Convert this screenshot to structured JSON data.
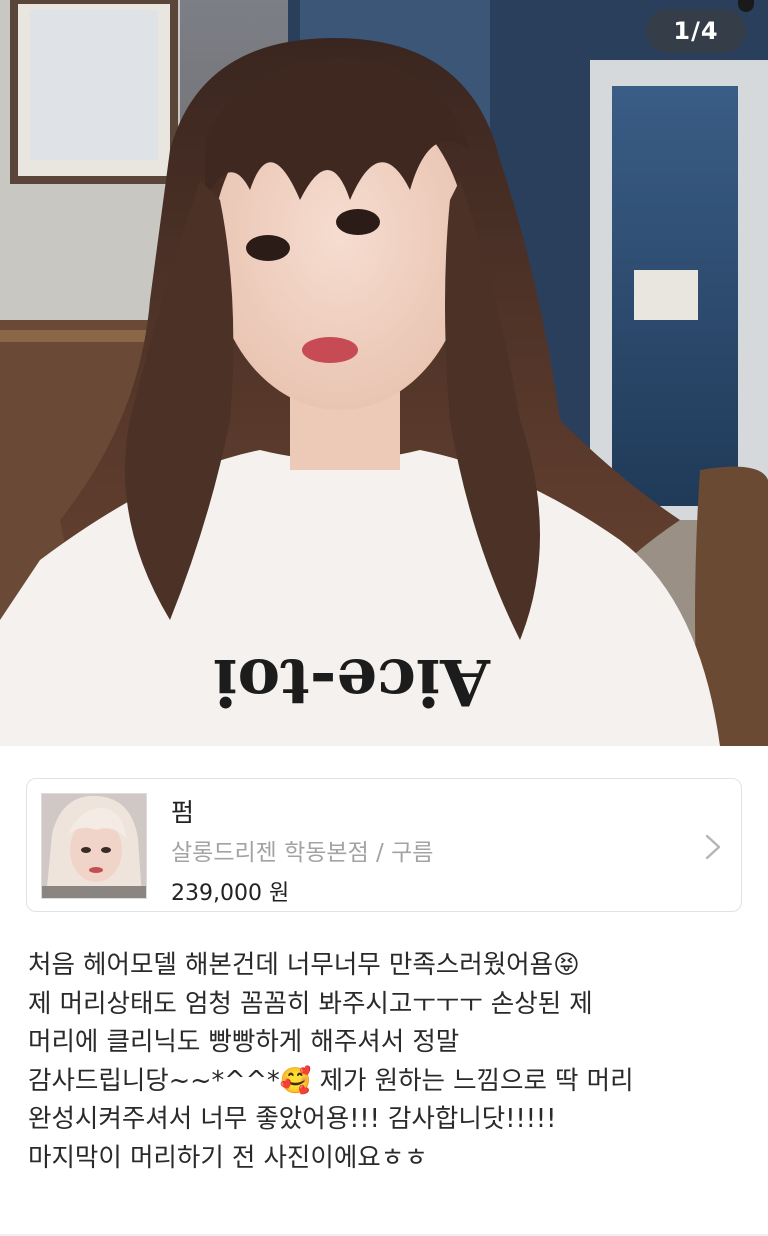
{
  "gallery": {
    "counter": "1/4",
    "photo": "selfie photo of woman with long wavy brown hair"
  },
  "product": {
    "title": "펌",
    "subtitle": "살롱드리젠 학동본점 / 구름",
    "price": "239,000 원",
    "chevron_icon": "chevron-right-icon"
  },
  "review": {
    "text": "처음 헤어모델 해본건데 너무너무 만족스러웠어욤😝\n제 머리상태도 엄청 꼼꼼히 봐주시고ㅜㅜㅜ 손상된 제\n머리에 클리닉도 빵빵하게 해주셔서 정말\n감사드립니당~~*^^*🥰 제가 원하는 느낌으로 딱 머리\n완성시켜주셔서 너무 좋았어용!!! 감사합니닷!!!!!\n마지막이 머리하기 전 사진이에요ㅎㅎ"
  }
}
